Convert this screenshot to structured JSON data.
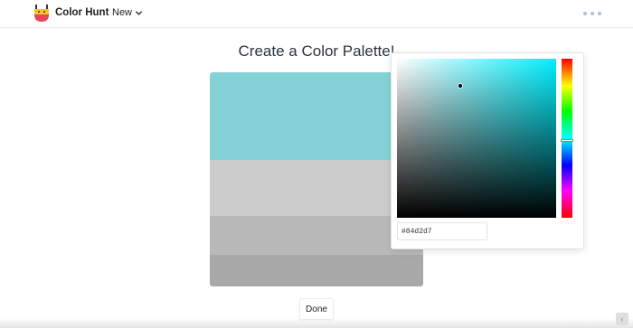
{
  "header": {
    "brand": "Color Hunt",
    "new_label": "New",
    "logo_icon": "paint-bucket-logo-icon",
    "menu_icon": "more-dots-icon"
  },
  "main": {
    "title": "Create a Color Palette!",
    "done_label": "Done"
  },
  "palette": {
    "swatches": [
      {
        "color": "#84d2d7",
        "share": 0.41
      },
      {
        "color": "#cccccc",
        "share": 0.26
      },
      {
        "color": "#b9b9b9",
        "share": 0.18
      },
      {
        "color": "#a8a8a8",
        "share": 0.15
      }
    ]
  },
  "picker": {
    "hex_value": "#84d2d7",
    "hue_color": "#00f0ff",
    "hue_level": 0.51,
    "saturation": 0.4,
    "brightness": 0.83
  },
  "colors": {
    "accent_dots": "#a9c2e0",
    "text": "#2b3440"
  }
}
